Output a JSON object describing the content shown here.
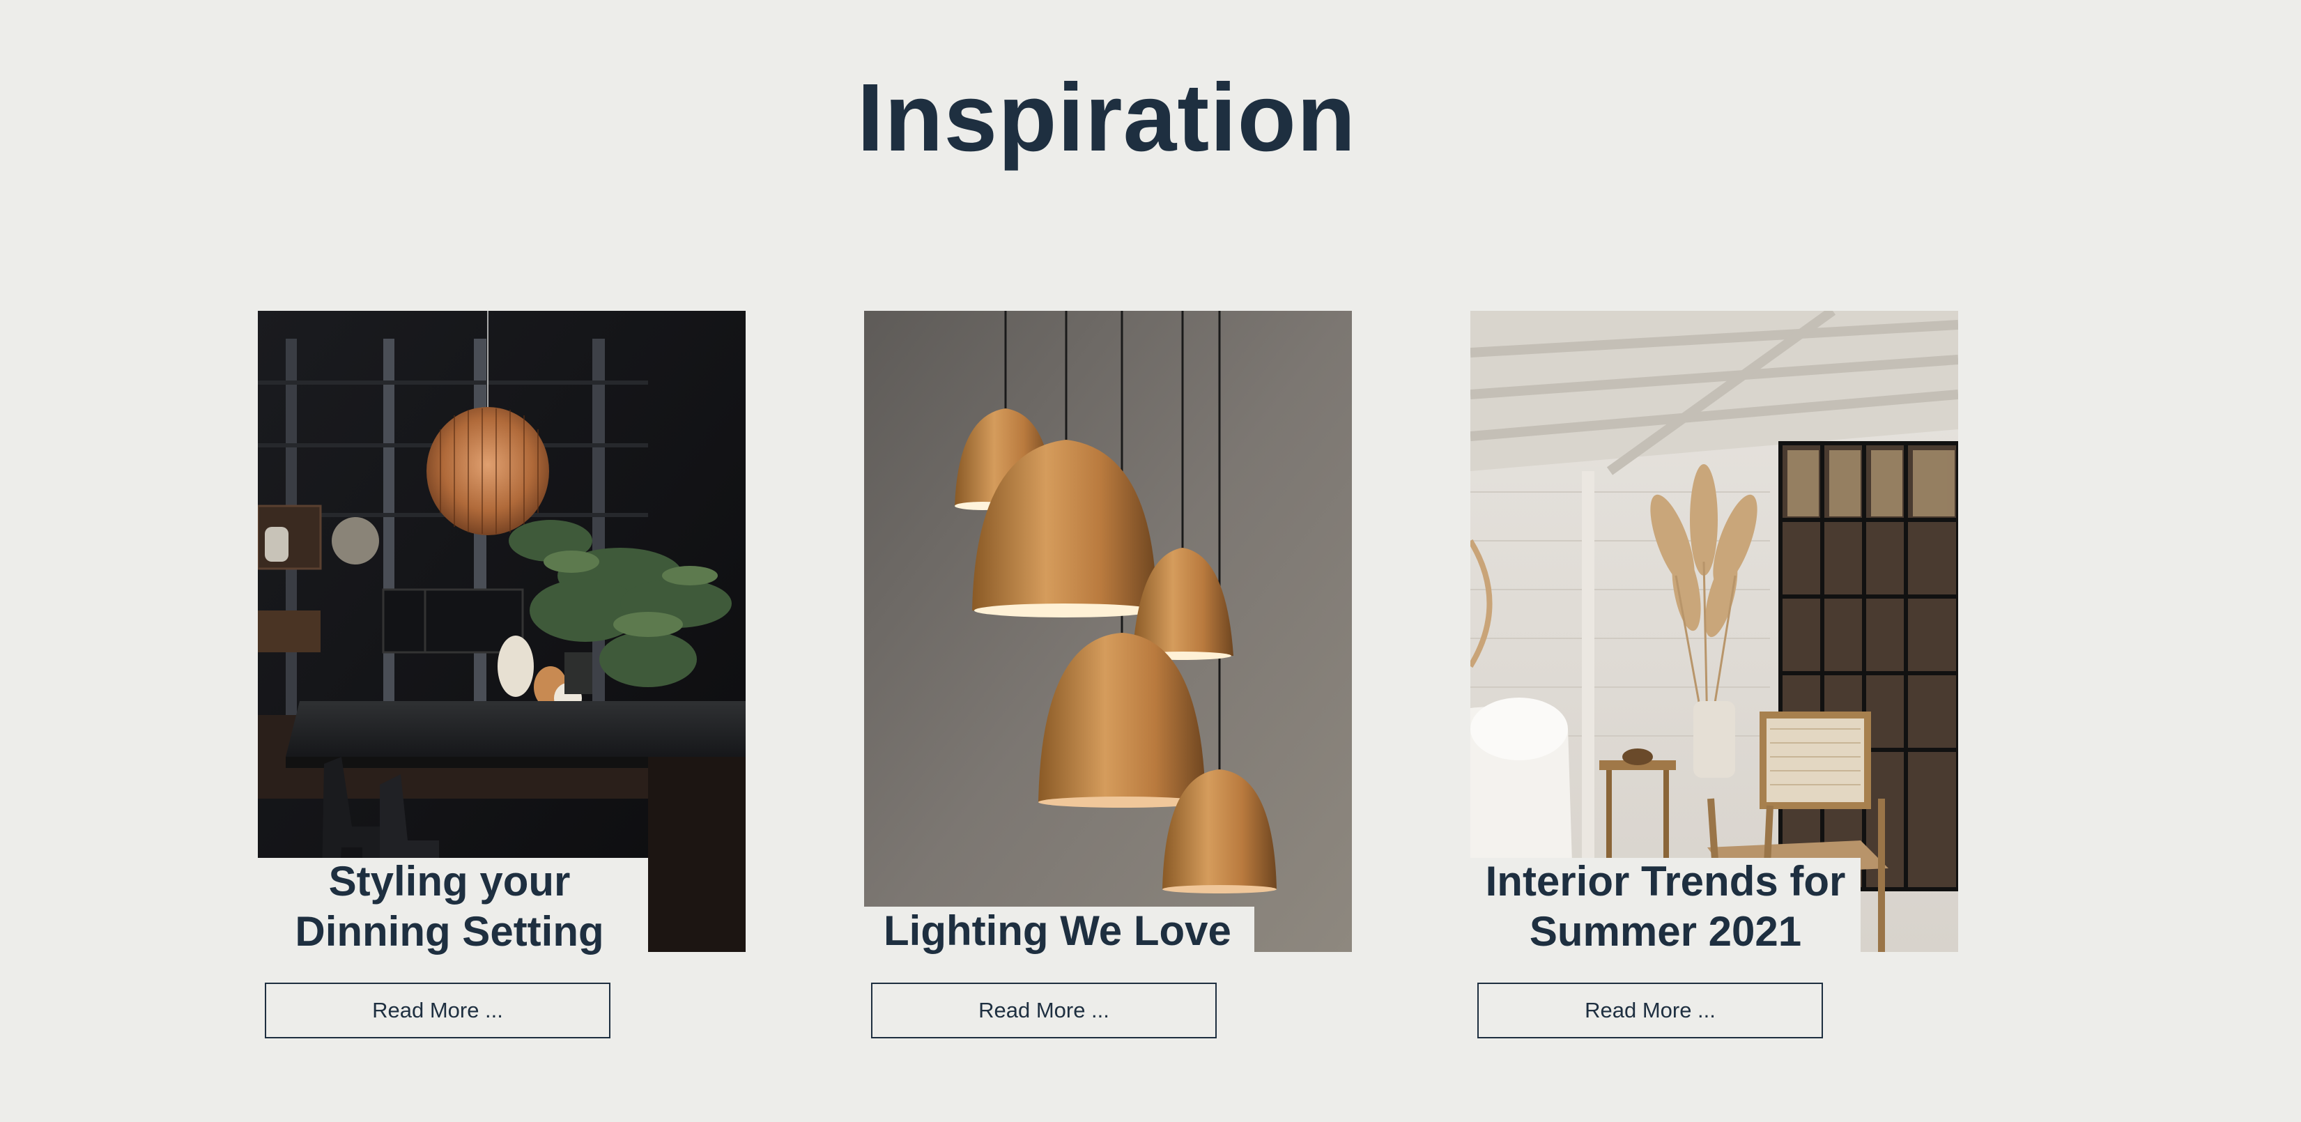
{
  "page": {
    "title": "Inspiration",
    "background": "#ededea",
    "text_color": "#1e2f40"
  },
  "cards": [
    {
      "title": "Styling your Dinning Setting",
      "button": "Read More ...",
      "image_subject": "dark-dining-room-with-copper-pendant-lamp"
    },
    {
      "title": "Lighting We Love",
      "button": "Read More ...",
      "image_subject": "cluster-of-copper-pendant-lamps"
    },
    {
      "title": "Interior Trends for Summer 2021",
      "button": "Read More ...",
      "image_subject": "bright-room-with-pampas-grass-and-rattan-chair"
    }
  ]
}
